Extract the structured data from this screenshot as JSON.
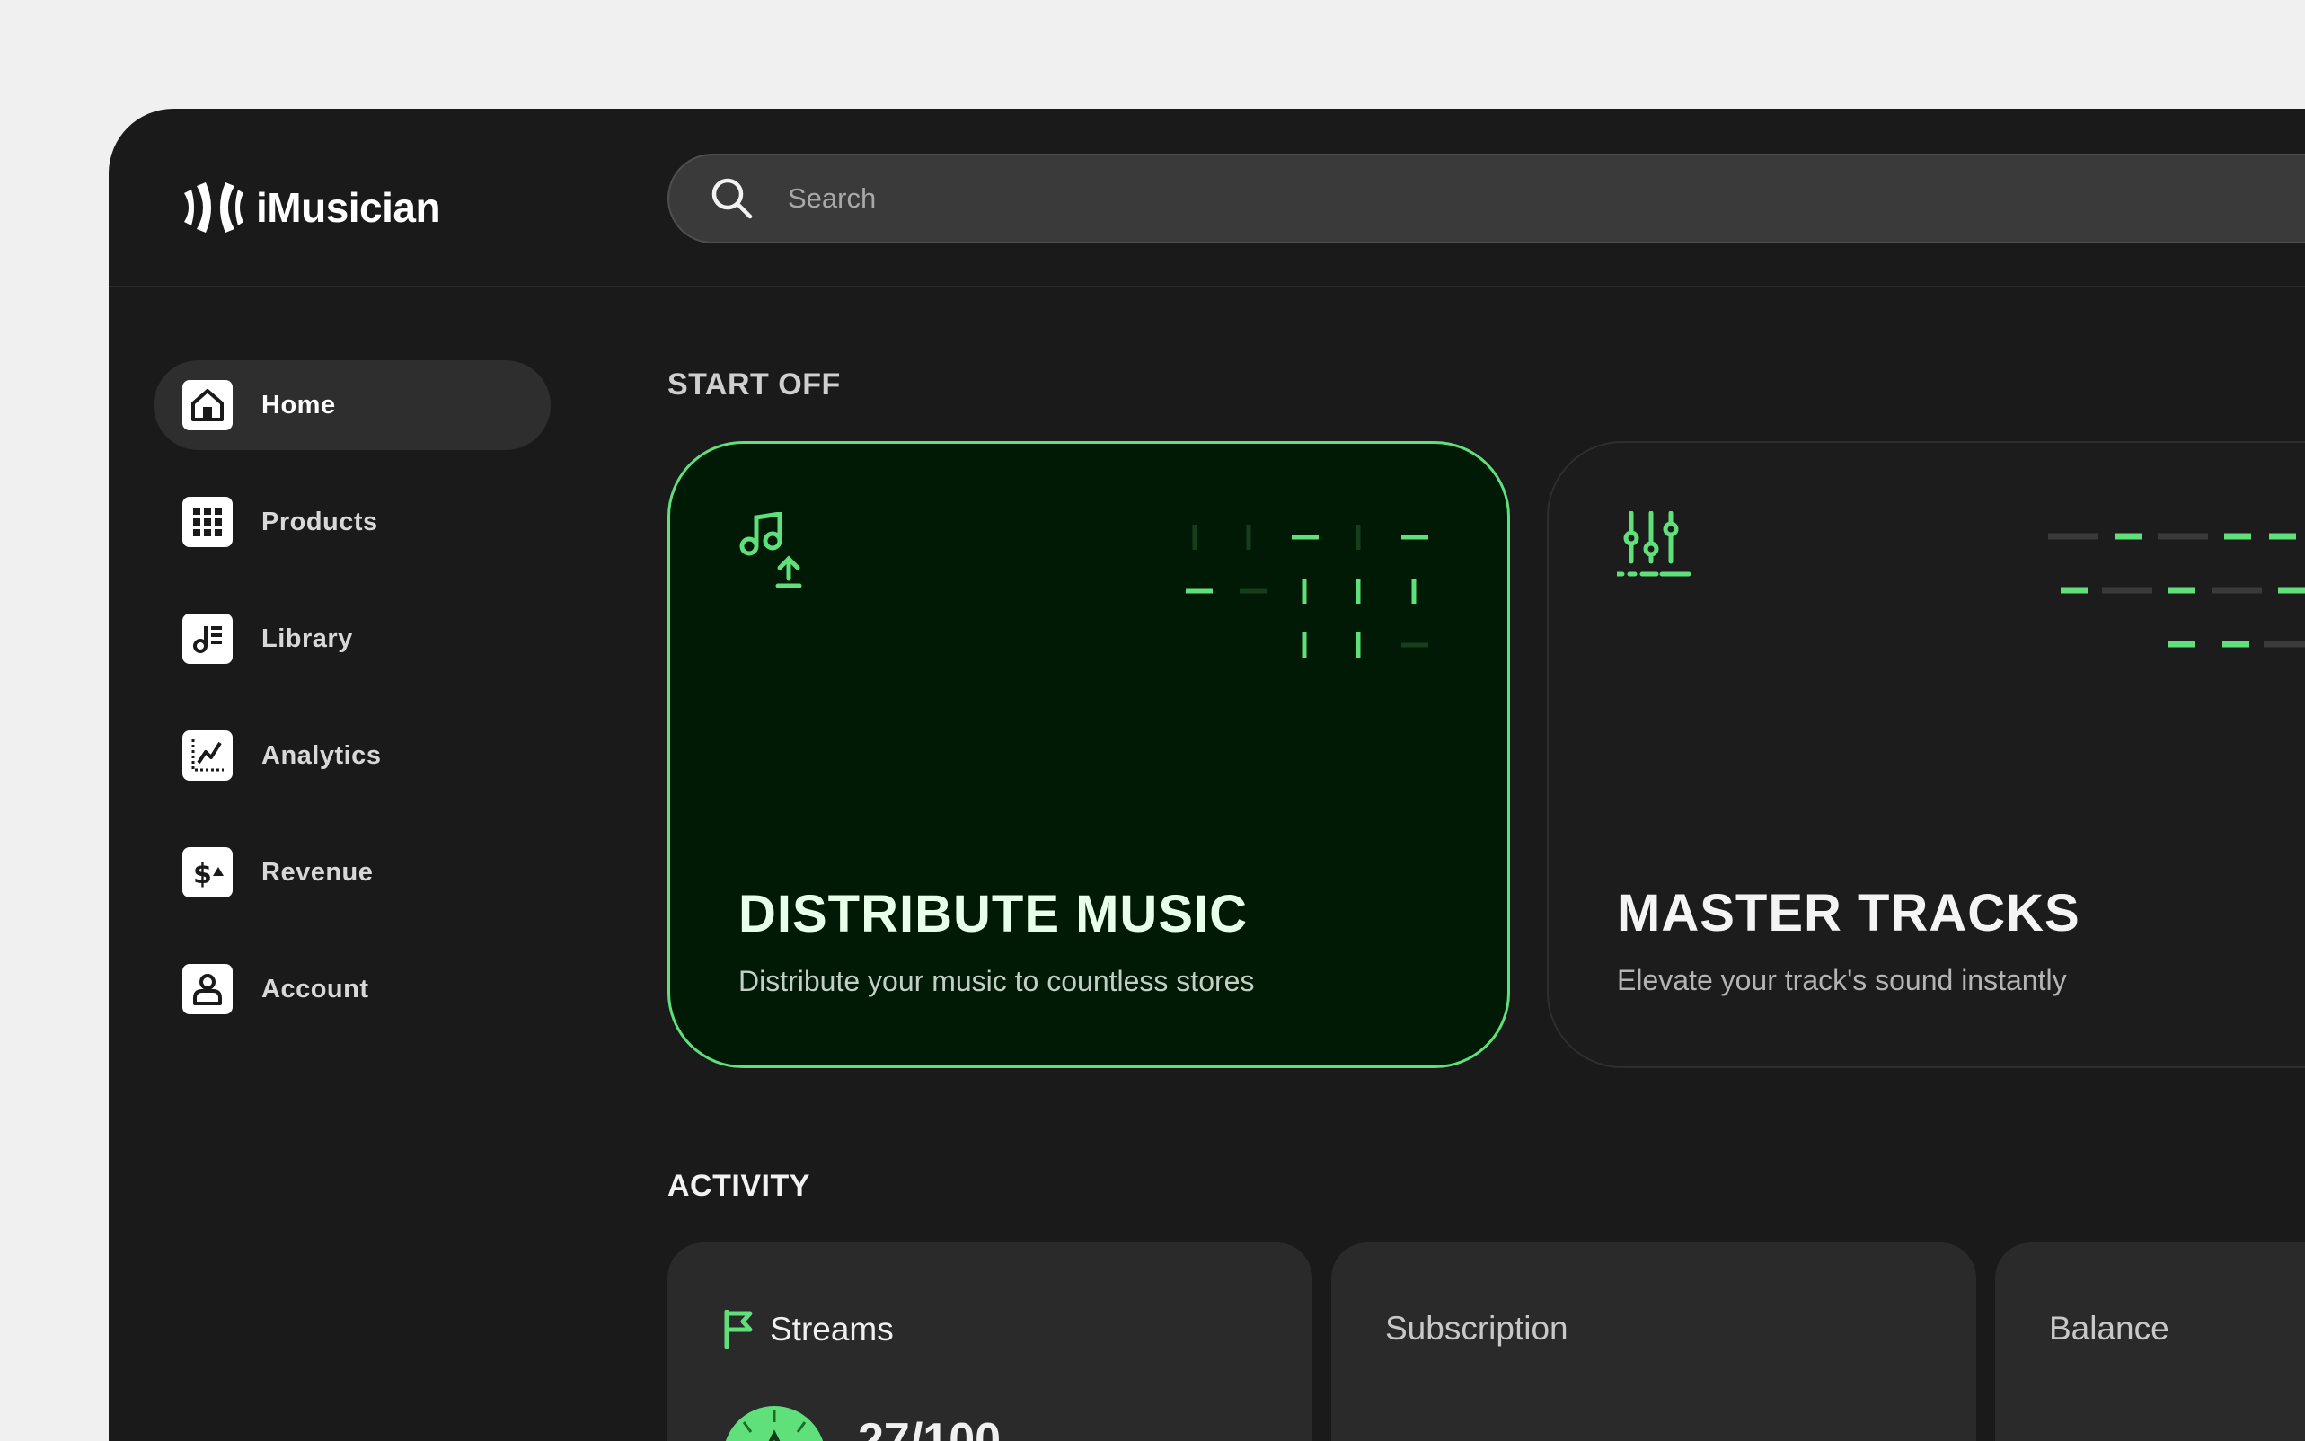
{
  "app": {
    "brand": "iMusician"
  },
  "search": {
    "placeholder": "Search",
    "icon": "search-icon"
  },
  "sidebar": {
    "items": [
      {
        "label": "Home",
        "icon": "home-icon",
        "active": true
      },
      {
        "label": "Products",
        "icon": "grid-icon",
        "active": false
      },
      {
        "label": "Library",
        "icon": "music-list-icon",
        "active": false
      },
      {
        "label": "Analytics",
        "icon": "chart-icon",
        "active": false
      },
      {
        "label": "Revenue",
        "icon": "dollar-icon",
        "active": false
      },
      {
        "label": "Account",
        "icon": "user-icon",
        "active": false
      }
    ]
  },
  "start_off": {
    "title": "START OFF",
    "cards": [
      {
        "title": "DISTRIBUTE MUSIC",
        "subtitle": "Distribute your music to countless stores",
        "icon": "music-upload-icon",
        "accent": "#5fe07a"
      },
      {
        "title": "MASTER TRACKS",
        "subtitle": "Elevate your track's sound instantly",
        "icon": "sliders-icon"
      }
    ]
  },
  "activity": {
    "title": "ACTIVITY",
    "cards": [
      {
        "label": "Streams",
        "icon": "flag-icon",
        "value": "27/100"
      },
      {
        "label": "Subscription"
      },
      {
        "label": "Balance"
      }
    ]
  },
  "colors": {
    "accent": "#5fe07a",
    "background": "#1a1a1a",
    "page": "#f0f0f0"
  }
}
